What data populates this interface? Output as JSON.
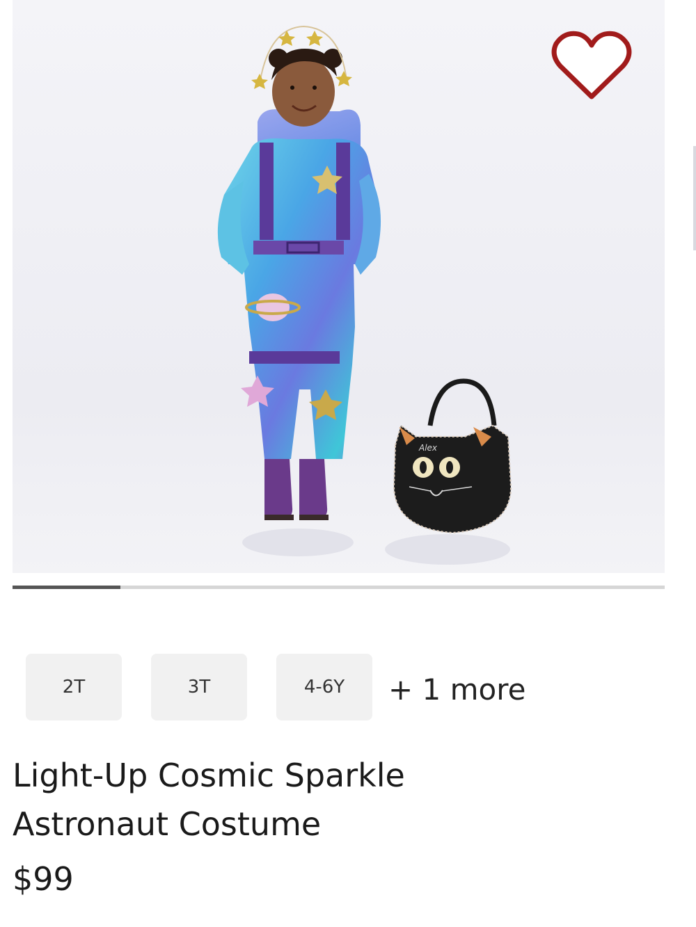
{
  "product": {
    "title_line1": "Light-Up Cosmic Sparkle",
    "title_line2": "Astronaut Costume",
    "price": "$99",
    "basket_name": "Alex"
  },
  "sizes": [
    "2T",
    "3T",
    "4-6Y"
  ],
  "more_sizes_label": "+ 1 more",
  "carousel": {
    "current_fraction": 0.165
  },
  "icons": {
    "wishlist": "heart-outline-icon"
  },
  "colors": {
    "heart": "#a11b1b",
    "progress": "#555555",
    "track": "#d6d6d6"
  }
}
